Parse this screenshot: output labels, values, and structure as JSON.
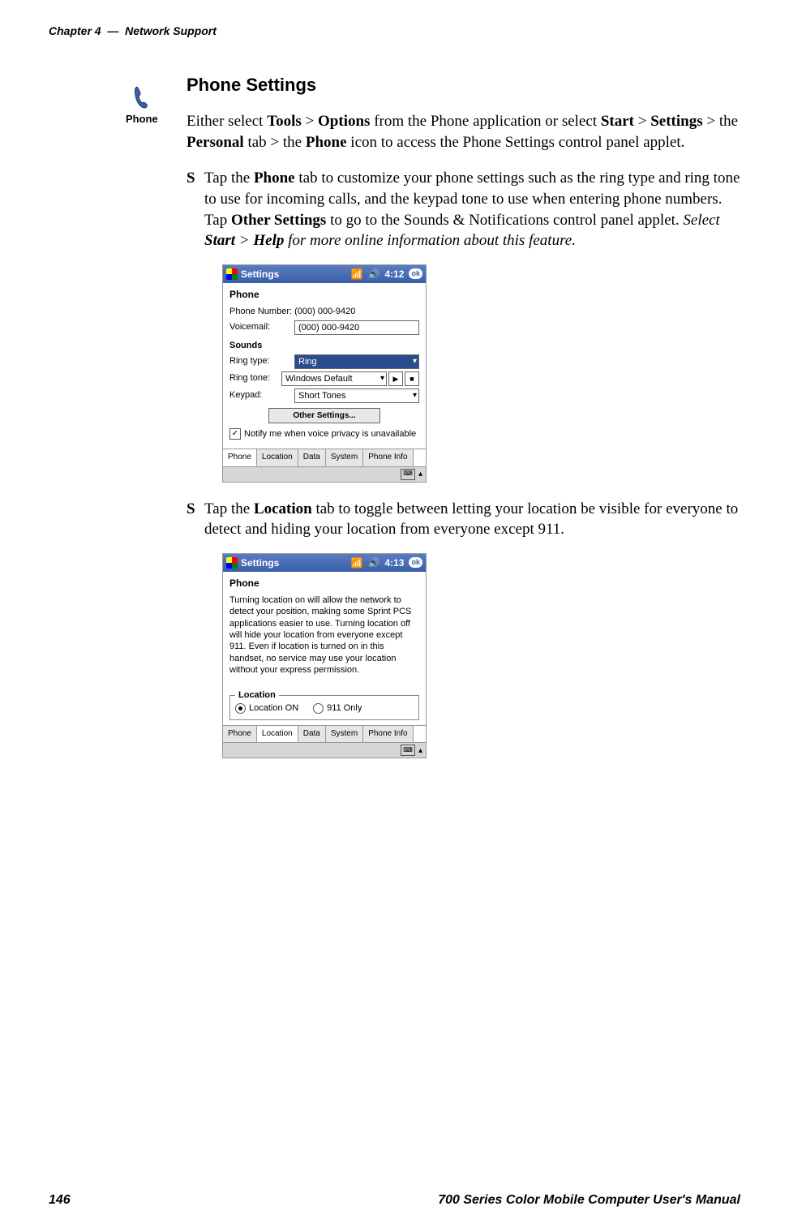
{
  "header": {
    "chapter": "Chapter 4",
    "sep": "—",
    "title": "Network Support"
  },
  "section_title": "Phone Settings",
  "phone_icon_label": "Phone",
  "intro": {
    "p1a": "Either select ",
    "p1b": "Tools",
    "p1c": " > ",
    "p1d": "Options",
    "p1e": " from the Phone application or select ",
    "p1f": "Start",
    "p1g": " > ",
    "p1h": "Settings",
    "p1i": " > the ",
    "p1j": "Personal",
    "p1k": " tab > the ",
    "p1l": "Phone",
    "p1m": " icon to access the Phone Settings control panel applet."
  },
  "bullet1": {
    "a": "Tap the ",
    "b": "Phone",
    "c": " tab to customize your phone settings such as the ring type and ring tone to use for incoming calls, and the keypad tone to use when entering phone numbers. Tap ",
    "d": "Other Settings",
    "e": " to go to the Sounds & Notifications control panel applet. ",
    "f": "Select ",
    "g": "Start",
    "h": " > ",
    "i": "Help",
    "j": " for more online information about this feature."
  },
  "bullet2": {
    "a": "Tap the ",
    "b": "Location",
    "c": " tab to toggle between letting your location be visible for everyone to detect and hiding your location from everyone except 911."
  },
  "shot1": {
    "header_title": "Settings",
    "time": "4:12",
    "ok": "ok",
    "app_title": "Phone",
    "phone_number_label": "Phone Number:",
    "phone_number_value": "(000) 000-9420",
    "voicemail_label": "Voicemail:",
    "voicemail_value": "(000) 000-9420",
    "sounds_label": "Sounds",
    "ringtype_label": "Ring type:",
    "ringtype_value": "Ring",
    "ringtone_label": "Ring tone:",
    "ringtone_value": "Windows Default",
    "keypad_label": "Keypad:",
    "keypad_value": "Short Tones",
    "other_btn": "Other Settings...",
    "notify_text": "Notify me when voice privacy is unavailable",
    "tabs": [
      "Phone",
      "Location",
      "Data",
      "System",
      "Phone Info"
    ],
    "active_tab": 0
  },
  "shot2": {
    "header_title": "Settings",
    "time": "4:13",
    "ok": "ok",
    "app_title": "Phone",
    "body": "Turning location on will allow the network to detect your position, making some Sprint PCS applications easier to use.  Turning location off will hide your location from everyone except 911.  Even if location is turned on in this handset, no service may use your location without your express permission.",
    "legend": "Location",
    "radio_on": "Location ON",
    "radio_911": "911 Only",
    "tabs": [
      "Phone",
      "Location",
      "Data",
      "System",
      "Phone Info"
    ],
    "active_tab": 1
  },
  "footer": {
    "page": "146",
    "title": "700 Series Color Mobile Computer User's Manual"
  }
}
